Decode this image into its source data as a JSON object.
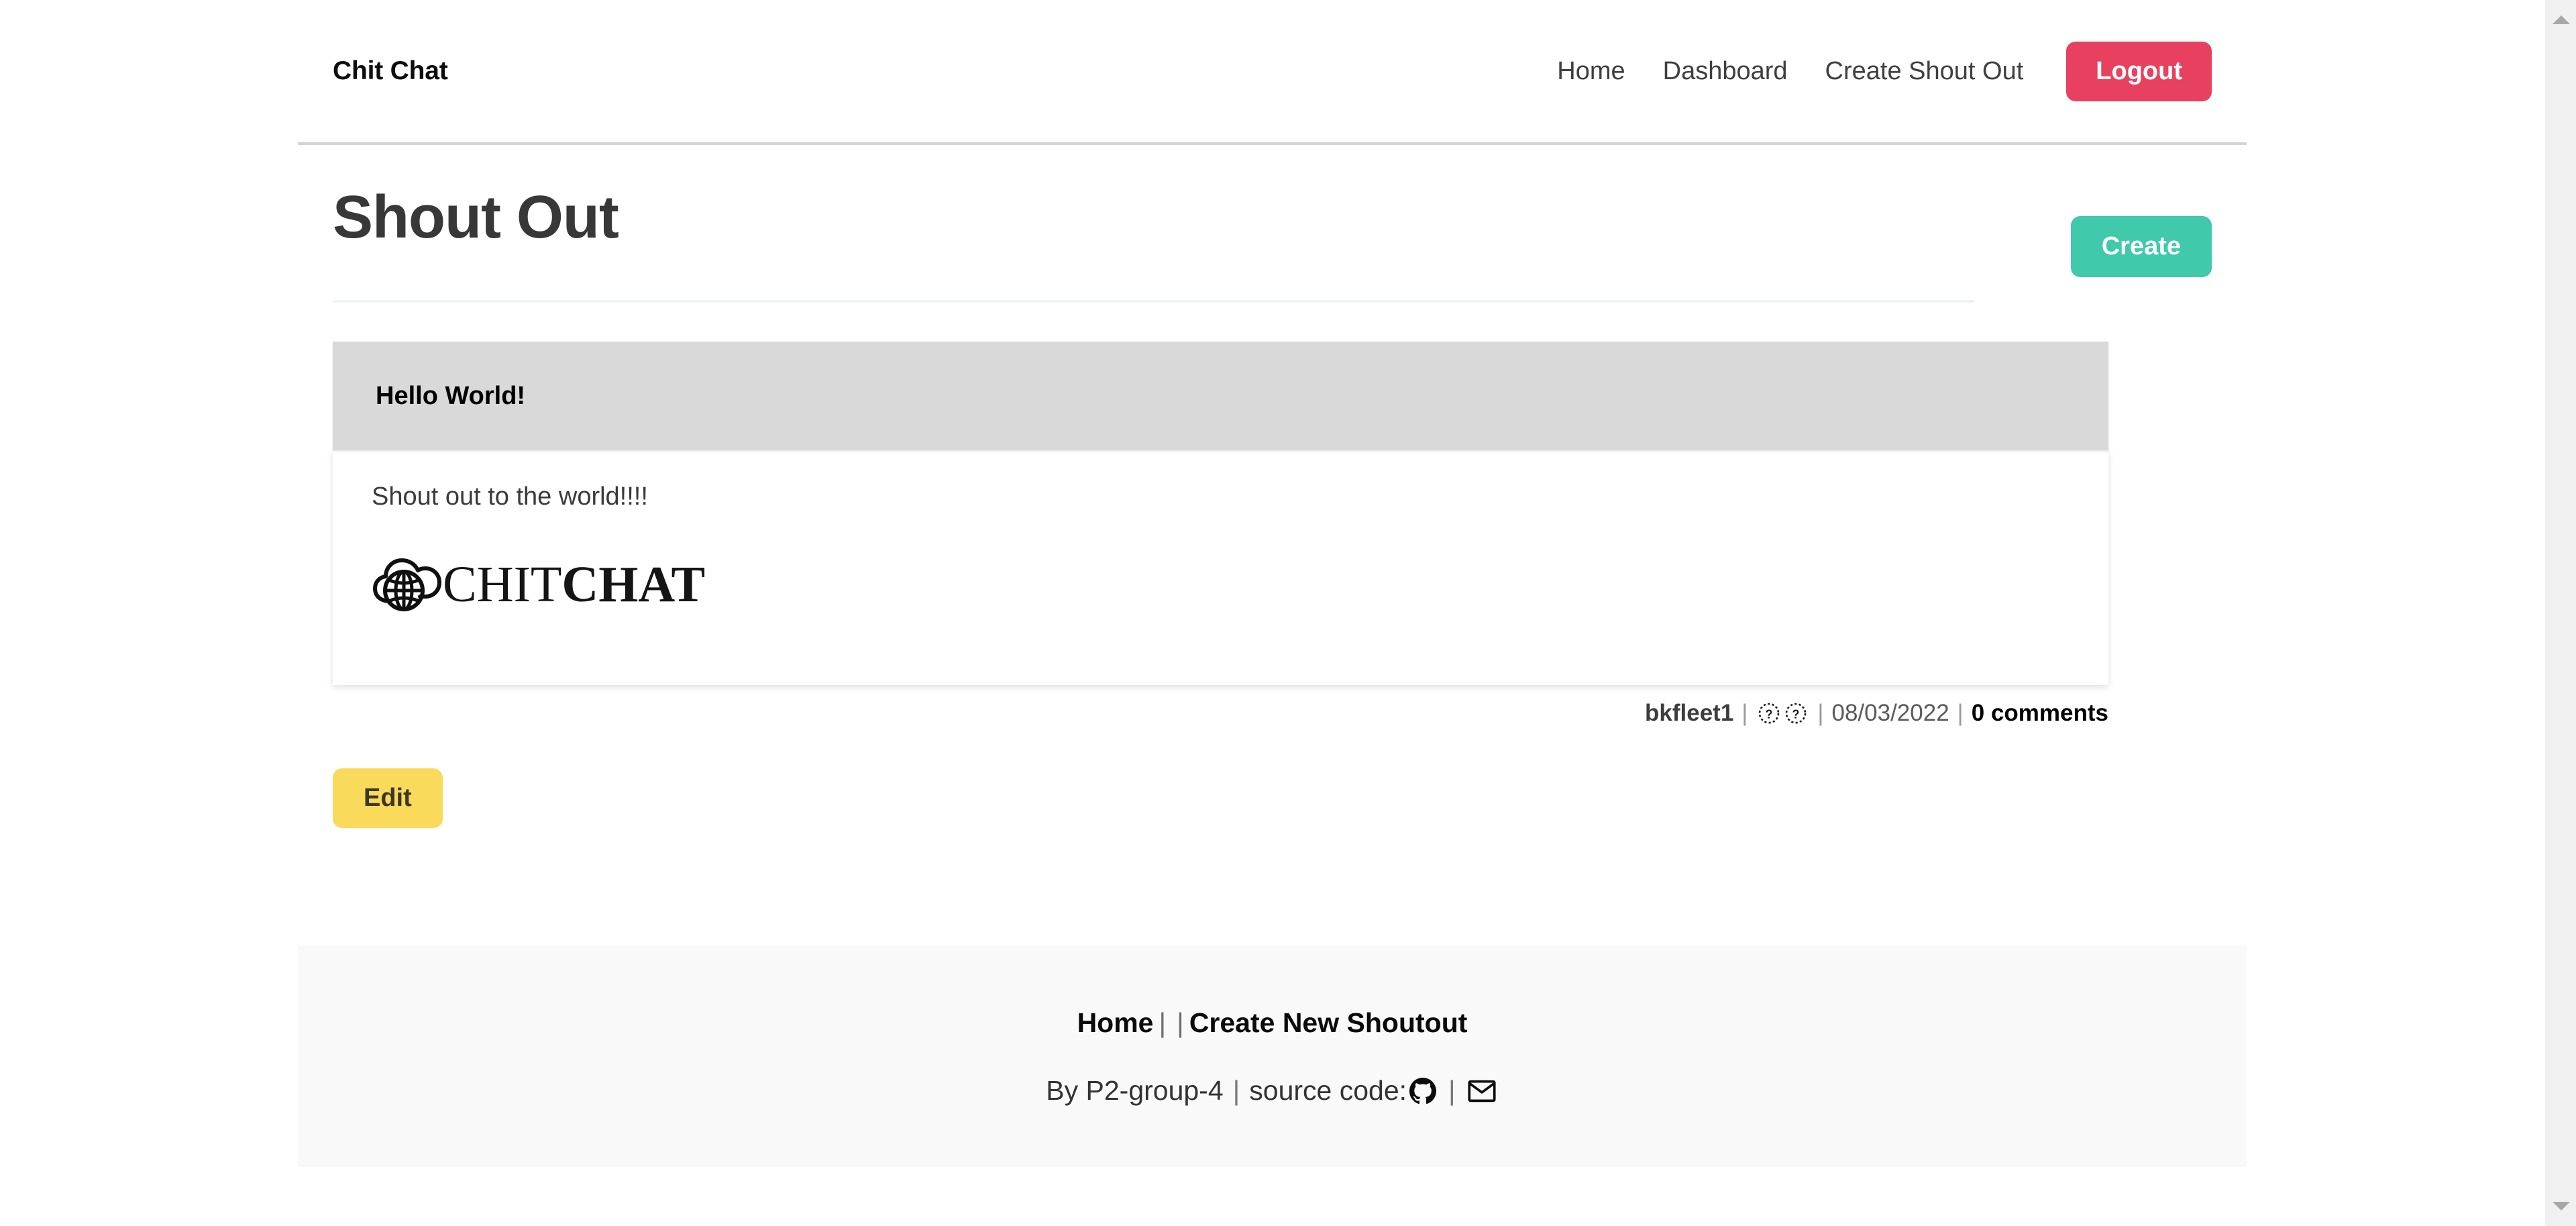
{
  "navbar": {
    "brand": "Chit Chat",
    "links": [
      {
        "label": "Home"
      },
      {
        "label": "Dashboard"
      },
      {
        "label": "Create Shout Out"
      }
    ],
    "logout_label": "Logout",
    "logout_color": "#e8415f"
  },
  "main": {
    "page_title": "Shout Out",
    "create_label": "Create",
    "create_color": "#40c9ab"
  },
  "shoutout": {
    "header_title": "Hello World!",
    "body_text": "Shout out to the world!!!!",
    "logo": {
      "icon_name": "cloud-globe-icon",
      "word_light": "CHIT",
      "word_bold": "CHAT"
    },
    "meta": {
      "author": "bkfleet1",
      "sep1": "|",
      "icon_1": "missing-glyph-icon",
      "icon_2": "missing-glyph-icon",
      "sep2": "|",
      "date": "08/03/2022",
      "sep3": "|",
      "comments": "0 comments"
    },
    "edit_label": "Edit",
    "edit_color": "#fada5a"
  },
  "footer": {
    "home_label": "Home",
    "sep_a": "|",
    "sep_b": "|",
    "create_label": "Create New Shoutout",
    "credit_prefix": "By P2-group-4",
    "credit_sep1": "|",
    "source_label": "source code:",
    "github_icon": "github-icon",
    "credit_sep2": "|",
    "email_icon": "envelope-icon"
  },
  "scrollbar": {
    "up_icon": "scroll-up-arrow-icon",
    "down_icon": "scroll-down-arrow-icon"
  }
}
